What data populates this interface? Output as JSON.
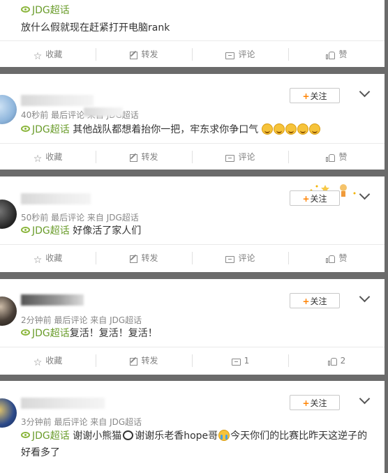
{
  "posts": [
    {
      "meta": "",
      "topic": "JDG超话",
      "text": "放什么假就现在赶紧打开电脑rank",
      "actions": {
        "collect": "收藏",
        "repost": "转发",
        "comment": "评论",
        "like": "赞"
      }
    },
    {
      "meta": "40秒前 最后评论  来自 JDG超话",
      "follow": "关注",
      "topic": "JDG超话",
      "text": "其他战队都想着抬你一把，牢东求你争口气",
      "actions": {
        "collect": "收藏",
        "repost": "转发",
        "comment": "评论",
        "like": "赞"
      }
    },
    {
      "meta": "50秒前 最后评论 来自 JDG超话",
      "follow": "关注",
      "topic": "JDG超话",
      "text": "好像活了家人们",
      "actions": {
        "collect": "收藏",
        "repost": "转发",
        "comment": "评论",
        "like": "赞"
      }
    },
    {
      "meta": "2分钟前 最后评论 来自 JDG超话",
      "follow": "关注",
      "topic": "JDG超话",
      "text": "复活！复活！复活！",
      "actions": {
        "collect": "收藏",
        "repost": "转发",
        "comment": "1",
        "like": "2"
      }
    },
    {
      "meta": "3分钟前 最后评论 来自 JDG超话",
      "follow": "关注",
      "topic": "JDG超话",
      "text_a": "谢谢小熊猫",
      "text_b": "谢谢乐老香hope哥",
      "text_c": "今天你们的比赛比昨天这逆子的好看多了"
    }
  ],
  "colors": {
    "accent": "#ff8200",
    "topic": "#6a9c2b",
    "background": "#6b6b6b"
  }
}
